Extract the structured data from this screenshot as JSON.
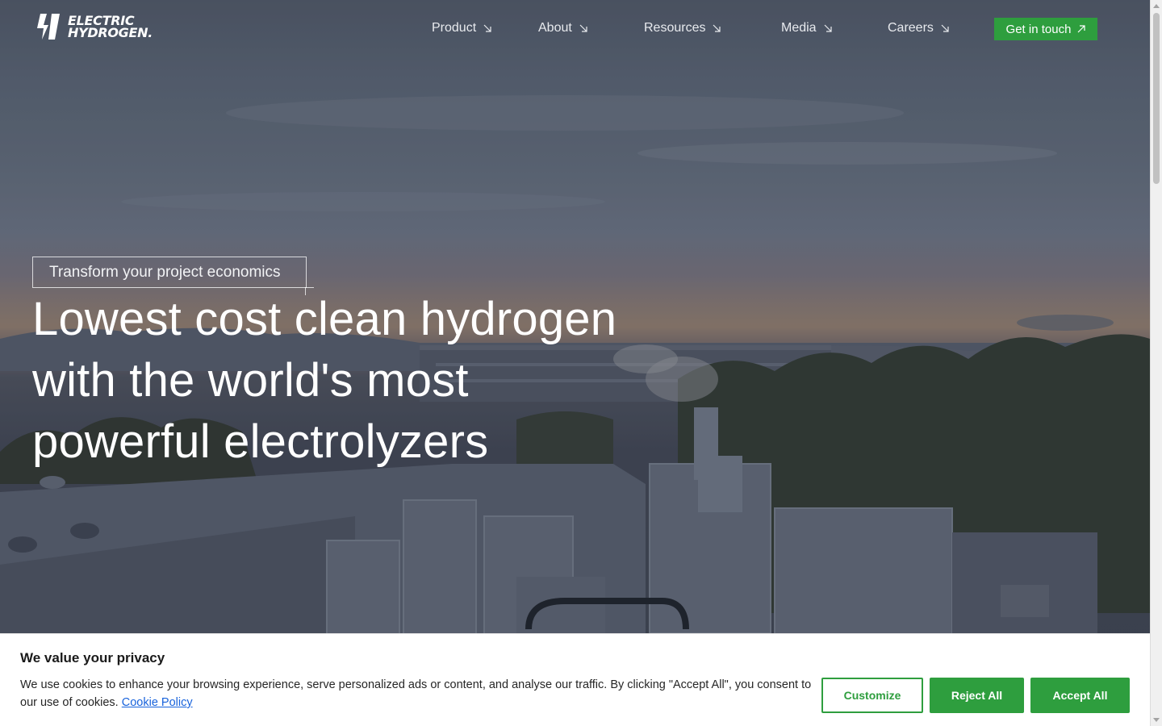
{
  "logo": {
    "line1": "ELECTRIC",
    "line2": "HYDROGEN.",
    "icon": "bolt-logo-icon"
  },
  "nav": {
    "items": [
      {
        "label": "Product",
        "icon": "arrow-down-right-icon"
      },
      {
        "label": "About",
        "icon": "arrow-down-right-icon"
      },
      {
        "label": "Resources",
        "icon": "arrow-down-right-icon"
      },
      {
        "label": "Media",
        "icon": "arrow-down-right-icon"
      },
      {
        "label": "Careers",
        "icon": "arrow-down-right-icon"
      }
    ],
    "cta_label": "Get in touch",
    "cta_icon": "arrow-up-right-icon"
  },
  "hero": {
    "eyebrow": "Transform your project economics",
    "headline_lines": [
      "Lowest cost clean hydrogen",
      "with the world's most",
      "powerful electrolyzers"
    ]
  },
  "cookie_banner": {
    "title": "We value your privacy",
    "body": "We use cookies to enhance your browsing experience, serve personalized ads or content, and analyse our traffic. By clicking \"Accept All\", you consent to our use of cookies.",
    "link_label": "Cookie Policy",
    "buttons": {
      "customize": "Customize",
      "reject": "Reject All",
      "accept": "Accept All"
    }
  },
  "colors": {
    "accent_green": "#2e9e3e",
    "link_blue": "#1863dc",
    "hero_overlay": "#3d4250"
  }
}
